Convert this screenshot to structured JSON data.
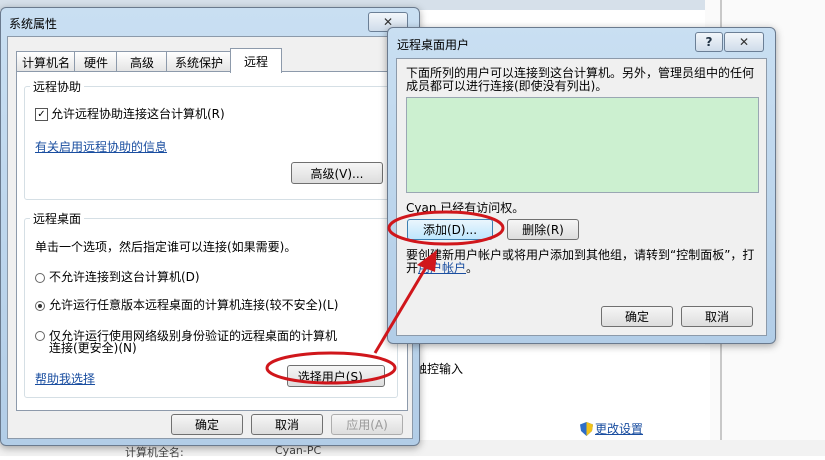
{
  "background": {
    "touch_label": "触控输入",
    "change_settings": "更改设置",
    "computer_name_label": "计算机全名:",
    "computer_name_value": "Cyan-PC"
  },
  "system_properties": {
    "title": "系统属性",
    "close_glyph": "✕",
    "tabs": [
      {
        "label": "计算机名"
      },
      {
        "label": "硬件"
      },
      {
        "label": "高级"
      },
      {
        "label": "系统保护"
      },
      {
        "label": "远程"
      }
    ],
    "remote_assistance": {
      "group_label": "远程协助",
      "allow_checkbox_label": "允许远程协助连接这台计算机(R)",
      "allow_checked": true,
      "info_link": "有关启用远程协助的信息",
      "advanced_button": "高级(V)..."
    },
    "remote_desktop": {
      "group_label": "远程桌面",
      "instruction": "单击一个选项，然后指定谁可以连接(如果需要)。",
      "options": [
        {
          "label": "不允许连接到这台计算机(D)",
          "selected": false
        },
        {
          "label": "允许运行任意版本远程桌面的计算机连接(较不安全)(L)",
          "selected": true
        },
        {
          "label": "仅允许运行使用网络级别身份验证的远程桌面的计算机连接(更安全)(N)",
          "selected": false
        }
      ],
      "help_link": "帮助我选择",
      "select_users_button": "选择用户(S)..."
    },
    "footer": {
      "ok": "确定",
      "cancel": "取消",
      "apply": "应用(A)"
    }
  },
  "remote_desktop_users": {
    "title": "远程桌面用户",
    "help_glyph": "?",
    "close_glyph": "✕",
    "description": "下面所列的用户可以连接到这台计算机。另外，管理员组中的任何成员都可以进行连接(即使没有列出)。",
    "access_text": "Cyan 已经有访问权。",
    "add_button": "添加(D)...",
    "remove_button": "删除(R)",
    "create_text": "要创建新用户帐户或将用户添加到其他组，请转到“控制面板”，打开",
    "user_accounts_link": "用户帐户",
    "create_text_end": "。",
    "ok": "确定",
    "cancel": "取消"
  },
  "colors": {
    "annotation_red": "#d0161b",
    "list_background": "#ccf0d0",
    "link": "#1a4ea0"
  }
}
